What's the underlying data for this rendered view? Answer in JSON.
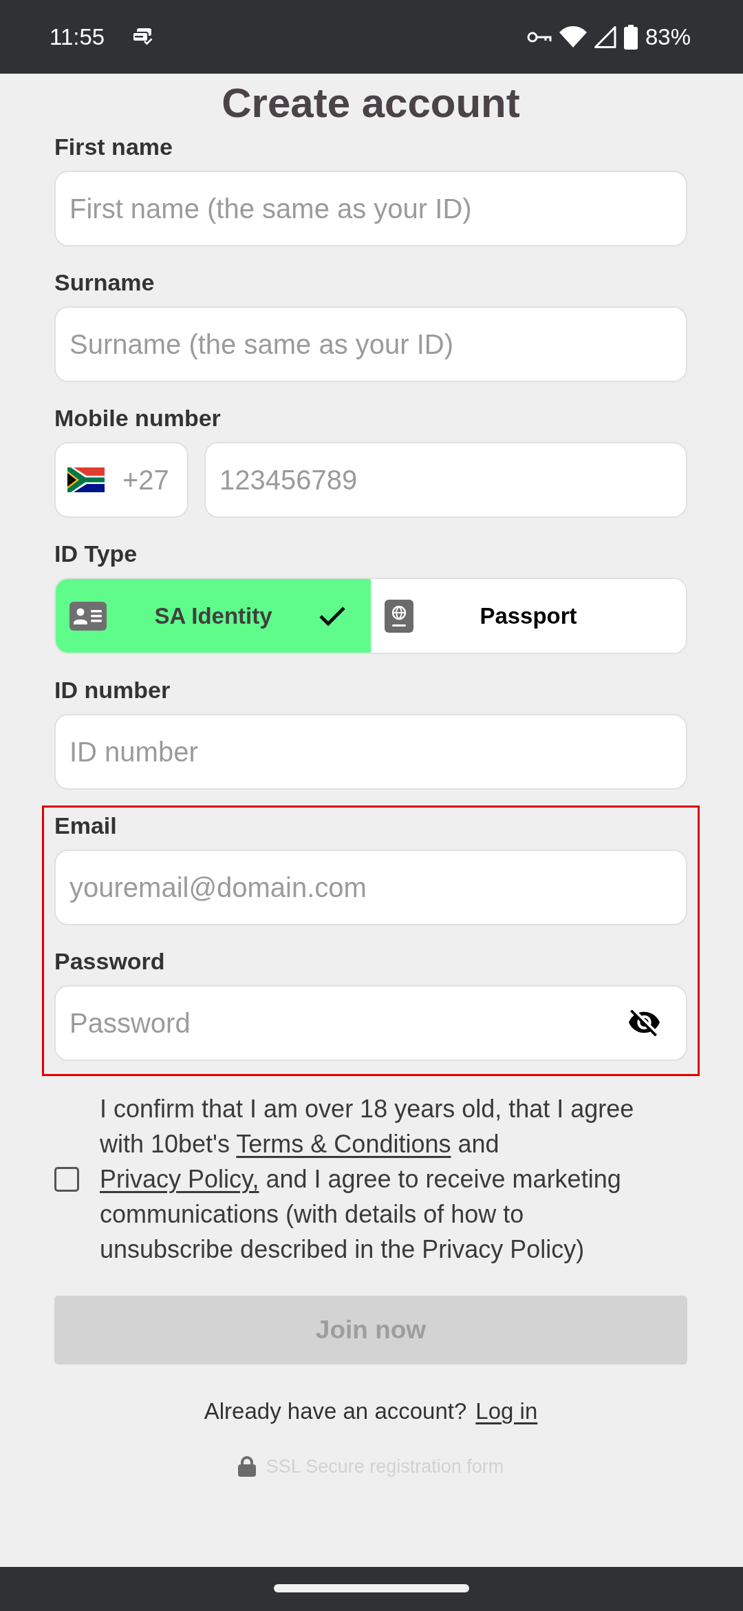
{
  "status_bar": {
    "time": "11:55",
    "battery": "83%"
  },
  "title": "Create account",
  "fields": [
    {
      "kind": "text",
      "label": "First name",
      "placeholder": "First name (the same as your ID)",
      "highlighted": false
    },
    {
      "kind": "text",
      "label": "Surname",
      "placeholder": "Surname (the same as your ID)",
      "highlighted": false
    },
    {
      "kind": "phone",
      "label": "Mobile number",
      "country_code": "+27",
      "placeholder": "123456789",
      "highlighted": false
    },
    {
      "kind": "segmented",
      "label": "ID Type",
      "options": [
        {
          "label": "SA Identity",
          "selected": true
        },
        {
          "label": "Passport",
          "selected": false
        }
      ],
      "highlighted": false
    },
    {
      "kind": "text",
      "label": "ID number",
      "placeholder": "ID number",
      "highlighted": false
    },
    {
      "kind": "text",
      "label": "Email",
      "placeholder": "youremail@domain.com",
      "highlighted": true
    },
    {
      "kind": "password",
      "label": "Password",
      "placeholder": "Password",
      "highlighted": true
    }
  ],
  "consent": {
    "checked": false,
    "parts": [
      {
        "kind": "text",
        "text": "I confirm that I am over 18 years old, that I agree with 10bet's "
      },
      {
        "kind": "link",
        "text": "Terms & Conditions"
      },
      {
        "kind": "text",
        "text": " and "
      },
      {
        "kind": "link",
        "text": "Privacy Policy,"
      },
      {
        "kind": "text",
        "text": " and I agree to receive marketing communications (with details of how to unsubscribe described in the Privacy Policy)"
      }
    ]
  },
  "join_button": {
    "label": "Join now",
    "disabled": true
  },
  "login_prompt": {
    "text": "Already have an account?",
    "link": "Log in"
  },
  "security_note": "SSL Secure registration form"
}
